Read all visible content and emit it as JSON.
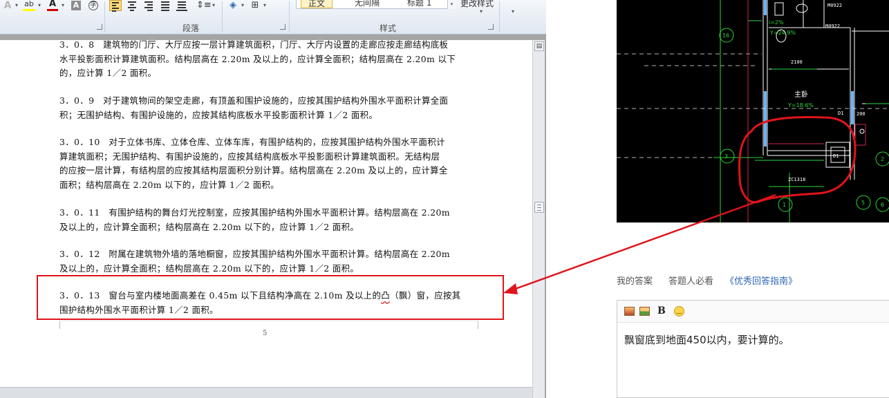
{
  "ribbon": {
    "paragraph_group_label": "段落",
    "styles_group_label": "样式",
    "style_normal": "正文",
    "style_no_spacing": "无间隔",
    "style_heading1": "标题 1",
    "change_styles": "更改样式"
  },
  "document": {
    "paragraphs": [
      {
        "lines": [
          "3．0．8　建筑物的门厅、大厅应按一层计算建筑面积，门厅、大厅内设置的走廊应按走廊结构底板",
          "水平投影面积计算建筑面积。结构层高在 2.20m 及以上的，应计算全面积；结构层高在 2.20m 以下",
          "的，应计算 1／2 面积。"
        ]
      },
      {
        "lines": [
          "3．0．9　对于建筑物间的架空走廊，有顶盖和围护设施的，应按其围护结构外围水平面积计算全面",
          "积；无围护结构、有围护设施的，应按其结构底板水平投影面积计算 1／2 面积。"
        ]
      },
      {
        "lines": [
          "3．0．10　对于立体书库、立体仓库、立体车库，有围护结构的，应按其围护结构外围水平面积计",
          "算建筑面积；无围护结构、有围护设施的，应按其结构底板水平投影面积计算建筑面积。无结构层",
          "的应按一层计算，有结构层的应按其结构层面积分别计算。结构层高在 2.20m 及以上的，应计算全",
          "面积；结构层高在 2.20m 以下的，应计算 1／2 面积。"
        ]
      },
      {
        "lines": [
          "3．0．11　有围护结构的舞台灯光控制室，应按其围护结构外围水平面积计算。结构层高在 2.20m",
          "及以上的，应计算全面积；结构层高在 2.20m 以下的，应计算 1／2 面积。"
        ]
      },
      {
        "lines": [
          "3．0．12　附属在建筑物外墙的落地橱窗，应按其围护结构外围水平面积计算。结构层高在 2.20m",
          "及以上的，应计算全面积；结构层高在 2.20m 以下的，应计算 1／2 面积。"
        ]
      }
    ],
    "highlighted": {
      "line1_before": "3．0．13　窗台与室内楼地面高差在 0.45m 以下且结构净高在 2.10m 及以上的",
      "line1_underlined": "凸",
      "line1_after": "（飘）窗，应按其",
      "line2": "围护结构外围水平面积计算 1／2 面积。"
    },
    "page_number": "5"
  },
  "qa": {
    "tab_my_answer": "我的答案",
    "tab_must_read": "答题人必看",
    "tab_guide": "《优秀回答指南》",
    "answer_text": "飘窗底到地面450以内，要计算的。"
  },
  "cad": {
    "labels": [
      "M0922",
      "M0922",
      "i=2%",
      "Y=24.9%",
      "2100",
      "主卧",
      "Y=18.6%",
      "D1",
      "200",
      "ZC1318",
      "D1",
      "1",
      "3",
      "5",
      "6",
      "16",
      "2"
    ]
  },
  "colors": {
    "annotation_red": "#e0141b",
    "link_blue": "#2d64b3",
    "cad_background": "#000000"
  }
}
